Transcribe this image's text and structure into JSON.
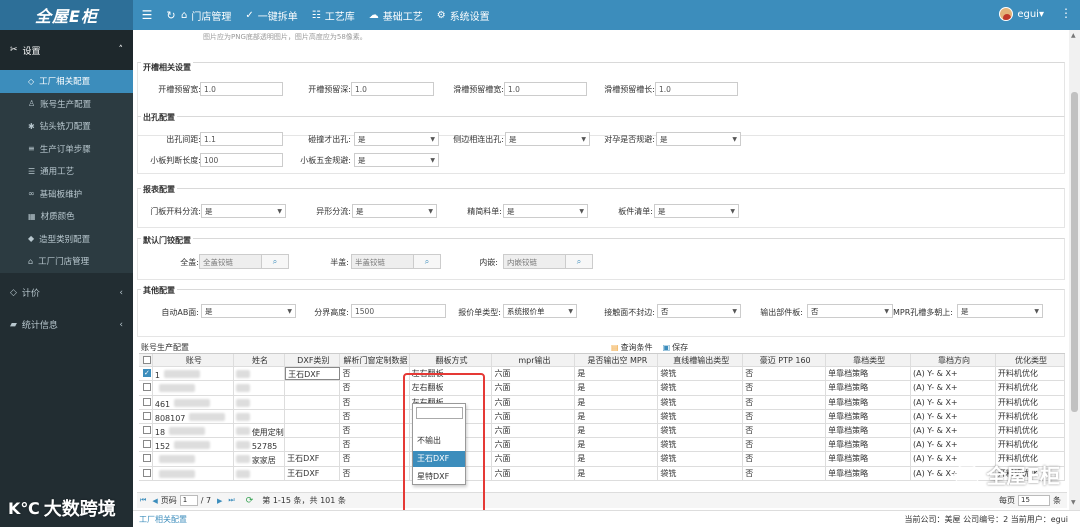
{
  "app": {
    "logo": "全屋E柜"
  },
  "topnav": {
    "items": [
      {
        "label": "门店管理",
        "icon": "store-icon"
      },
      {
        "label": "一键拆单",
        "icon": "check-circle-icon"
      },
      {
        "label": "工艺库",
        "icon": "bars-icon"
      },
      {
        "label": "基础工艺",
        "icon": "cloud-icon"
      },
      {
        "label": "系统设置",
        "icon": "gear-icon"
      }
    ],
    "user": "egui"
  },
  "sidebar": {
    "settings": "设置",
    "items": [
      "工厂相关配置",
      "账号生产配置",
      "钻头铣刀配置",
      "生产订单步骤",
      "通用工艺",
      "基础板维护",
      "材质颜色",
      "造型类别配置",
      "工厂门店管理"
    ],
    "active_index": 0,
    "group_pricing": "计价",
    "group_stats": "统计信息"
  },
  "content": {
    "hint": "图片应为PNG底部透明图片，图片高度应为58像素。",
    "slot": {
      "title": "开槽相关设置",
      "fields": [
        {
          "label": "开槽预留宽:",
          "value": "1.0"
        },
        {
          "label": "开槽预留深:",
          "value": "1.0"
        },
        {
          "label": "滑槽预留槽宽:",
          "value": "1.0"
        },
        {
          "label": "滑槽预留槽长:",
          "value": "1.0"
        }
      ]
    },
    "hole": {
      "title": "出孔配置",
      "hole_spacing": {
        "label": "出孔间距:",
        "value": "1.1"
      },
      "collide": {
        "label": "碰撞才出孔:",
        "value": "是"
      },
      "side_hole": {
        "label": "侧边相连出孔:",
        "value": "是"
      },
      "avoid": {
        "label": "对孕是否规避:",
        "value": "是"
      },
      "small_len": {
        "label": "小板判断长度:",
        "value": "100"
      },
      "small_hw": {
        "label": "小板五金规避:",
        "value": "是"
      }
    },
    "report": {
      "title": "报表配置",
      "fields": [
        {
          "label": "门板开料分流:",
          "value": "是"
        },
        {
          "label": "异形分流:",
          "value": "是"
        },
        {
          "label": "精简料单:",
          "value": "是"
        },
        {
          "label": "板件清单:",
          "value": "是"
        }
      ]
    },
    "hinge": {
      "title": "默认门铰配置",
      "fields": [
        {
          "label": "全盖:",
          "value": "全盖铰链"
        },
        {
          "label": "半盖:",
          "value": "半盖铰链"
        },
        {
          "label": "内嵌:",
          "value": "内嵌铰链"
        }
      ]
    },
    "other": {
      "title": "其他配置",
      "auto_ab": {
        "label": "自动AB面:",
        "value": "是"
      },
      "split_h": {
        "label": "分界高度:",
        "value": "1500"
      },
      "quote_type": {
        "label": "报价单类型:",
        "value": "系统报价单"
      },
      "contact": {
        "label": "接触面不封边:",
        "value": "否"
      },
      "output_part": {
        "label": "输出部件板:",
        "value": "否"
      },
      "mpr": {
        "label": "MPR孔槽多朝上:",
        "value": "是"
      }
    }
  },
  "grid": {
    "title": "账号生产配置",
    "query_label": "查询条件",
    "save_label": "保存",
    "columns": [
      "",
      "账号",
      "姓名",
      "DXF类别",
      "解析门窗定制数据",
      "翻板方式",
      "mpr输出",
      "是否输出空 MPR",
      "直线槽输出类型",
      "豪迈 PTP 160",
      "靠档类型",
      "靠档方向",
      "优化类型"
    ],
    "row_template": [
      "否",
      "左右翻板",
      "六面",
      "是",
      "袋铣",
      "否",
      "单靠档策略",
      "(A) Y- & X+",
      "开料机优化"
    ],
    "rows": [
      {
        "account": "1",
        "name": "",
        "dxf": "王石DXF",
        "checked": true
      },
      {
        "account": "",
        "name": "",
        "dxf": "",
        "checked": false
      },
      {
        "account": "461",
        "name": "",
        "dxf": "",
        "checked": false
      },
      {
        "account": "808107",
        "name": "",
        "dxf": "",
        "checked": false
      },
      {
        "account": "18",
        "name": "使用定制",
        "dxf": "",
        "checked": false
      },
      {
        "account": "152",
        "name": "52785",
        "dxf": "",
        "checked": false
      },
      {
        "account": "",
        "name": "家家居",
        "dxf": "王石DXF",
        "checked": false
      },
      {
        "account": "",
        "name": "",
        "dxf": "王石DXF",
        "checked": false
      }
    ],
    "dropdown": {
      "options": [
        "不输出",
        "王石DXF",
        "星特DXF"
      ],
      "highlight_index": 1
    },
    "pager": {
      "page_label": "页码",
      "page": "1",
      "total_pages": "/ 7",
      "range": "第 1-15 条，共 101 条",
      "per_page_label": "每页",
      "per_page": "15",
      "per_page_suffix": "条"
    }
  },
  "footer": {
    "tab": "工厂相关配置",
    "info": "当前公司：美屋   公司编号：2   当前用户：egui"
  },
  "watermark": {
    "left": "大数跨境",
    "right": "全屋E柜"
  }
}
